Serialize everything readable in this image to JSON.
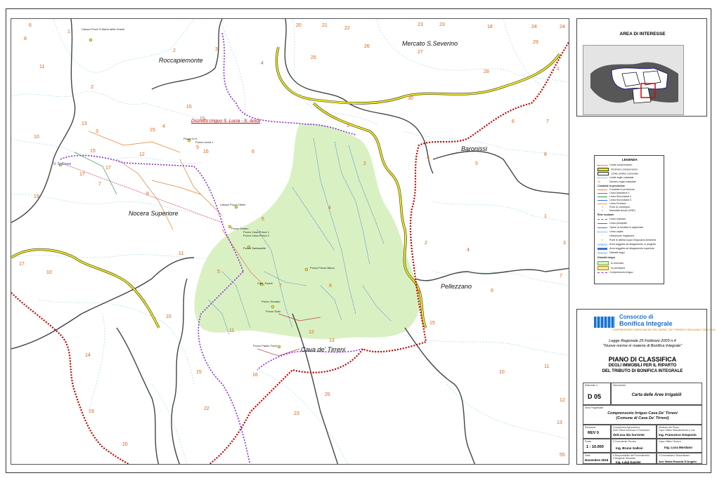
{
  "map": {
    "district_label": "Distretto irriguo S. Lucia - S. Anna",
    "towns": [
      "Roccapiemonte",
      "Mercato S.Severino",
      "Baronissi",
      "Nocera Superiore",
      "Pellezzano",
      "Cava de' Tirreni"
    ],
    "point_labels": [
      "Campo Pozzi S.Maria della Grazie",
      "V. S. Croce",
      "Pozzo D.H.",
      "Pozzo Uccia 1",
      "Campo Pozzi Cibelo",
      "Pozzo Sciano",
      "Pozzo Casa Prisco 1",
      "Pozzo Casa Prisco 2",
      "Pozzo Santarcelle",
      "Pozzo Pozzo Barco",
      "Cam. Parivli",
      "Pozzo Tornado",
      "Pozzo Scilo",
      "Pozzo Pastio Tironi"
    ],
    "sheet_numbers": [
      "6",
      "1",
      "8",
      "2",
      "3",
      "11",
      "4",
      "2",
      "20",
      "21",
      "22",
      "23",
      "23",
      "18",
      "24",
      "24",
      "26",
      "27",
      "29",
      "25",
      "28",
      "1",
      "30",
      "15",
      "15",
      "13",
      "4",
      "7",
      "6",
      "10",
      "3",
      "15",
      "1",
      "8",
      "5",
      "15",
      "12",
      "16",
      "6",
      "2",
      "4",
      "5",
      "7",
      "17",
      "17",
      "13",
      "8",
      "4",
      "1",
      "6",
      "2",
      "3",
      "7",
      "11",
      "5",
      "4",
      "17",
      "10",
      "7",
      "8",
      "9",
      "6",
      "10",
      "12",
      "13",
      "15",
      "11",
      "14",
      "15",
      "16",
      "11",
      "10",
      "25",
      "12",
      "19",
      "22",
      "23",
      "13",
      "20",
      "55"
    ]
  },
  "overview": {
    "title": "AREA DI INTERESSE"
  },
  "legend": {
    "title": "LEGENDA",
    "items": [
      "Limite comprensorio",
      "Perimetro comprensorio",
      "Limite confine comunale",
      "Limite foglio catastale",
      "Numero foglio catastale"
    ],
    "section_pipes": "Condotte in previsione",
    "pipe_items": [
      "Condotte in previsione",
      "Linea Adduttrice 1",
      "Linea Secondaria 2",
      "Linea Secondaria 3",
      "Linea Terziaria",
      "Punti di consegna",
      "Manufatti tecnici (VNP)"
    ],
    "section_drain": "Rete scolante",
    "drain_items": [
      "Linea Impluvio",
      "Linea principale",
      "Opere di bonifica in argine/ala",
      "Linea capita",
      "Ubicazione irrigazione",
      "Punti di attinta scopo irriguo/pot-ambiente",
      "Area soggetta ad allagamento in progetto",
      "Area soggetta ad allagamento superiore",
      "Distretti irrigui"
    ],
    "section_distr": "Distretti irrigui",
    "distr_items": [
      "In esercizio",
      "In previsione",
      "Comprensorio irriguo"
    ]
  },
  "title_block": {
    "brand_line1": "Consorzio di",
    "brand_line2": "Bonifica Integrale",
    "brand_sub": "COMPRENSORIO SARNO BACINO DEL SARNO, DEI TORRENTI VESUVIANI E DELL'IRNO",
    "law_line1": "Legge Regionale 25 Febbraio 2003 n.4",
    "law_line2": "\"Nuove norme in materia di Bonifica Integrale\"",
    "main_title": "PIANO DI CLASSIFICA",
    "subtitle1": "DEGLI IMMOBILI PER IL RIPARTO",
    "subtitle2": "DEL TRIBUTO DI BONIFICA INTEGRALE",
    "label_elaborato": "Elaborato n.",
    "elaborato": "D 05",
    "label_descrizione": "Descrizione",
    "descrizione": "Carta delle Aree Irrigabili",
    "label_area": "Area Progettuale",
    "area_line1": "Comprensorio Irriguo Cava De' Tirreni",
    "area_line2": "(Comune di Cava De' Tirreni)",
    "label_revisione": "Revisione",
    "revisione": "REV 0",
    "label_resp_agr": "Consulenza Agronomica",
    "resp_agr_sub": "Dott. Ettore Amoruso e Domenico",
    "resp_agr": "dott.ssa Ida Sorrente",
    "label_settore": "Direttore del Piano",
    "settore_sub": "Capo Ufficio Manutenzione e Lav.",
    "settore": "Ing. Francesco Gesponio",
    "label_scala": "Scala",
    "scala": "1 : 10.000",
    "label_collab": "Il Consulente Tecnico",
    "collab": "Ing. Bruno Gallesi",
    "label_capo": "Capo Ufficio Tecnico",
    "capo": "Ing. Luca Mordano",
    "label_data": "Data",
    "data": "Novembre 2016",
    "label_resp_proc": "Il Responsabile del Procedimento",
    "resp_proc_sub": "Il Dirigente Generale",
    "resp_proc": "Ing. Luigi Daniele",
    "label_commissario": "Il Commissario Straordinario",
    "commissario": "Avv. Maria Rosaria D'Angelo"
  },
  "colors": {
    "comprensorio": "#cc0000",
    "district": "#7b1fd0",
    "yellow_boundary": "#e8e400",
    "irrigated": "#d8f0c0",
    "municipal": "#333333",
    "brand": "#1b6fd1"
  }
}
